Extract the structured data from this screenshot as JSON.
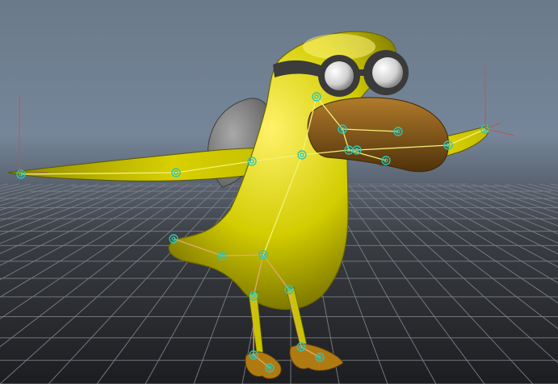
{
  "viewport": {
    "kind": "3d-viewport",
    "background_top": "#6a7a8a",
    "background_bottom": "#1c1d20",
    "grid_color": "#7a7f86",
    "model": {
      "name": "bird-character",
      "body_color": "#d7d400",
      "beak_color": "#8a5a12",
      "feet_color": "#b07a12",
      "goggle_frame_color": "#3a3a3a",
      "goggle_lens_color": "#ffffff",
      "skeleton_bone_color": "#f2f27a",
      "skeleton_joint_color": "#2ec6b3",
      "skeleton_leg_color": "#e7a86c"
    }
  }
}
